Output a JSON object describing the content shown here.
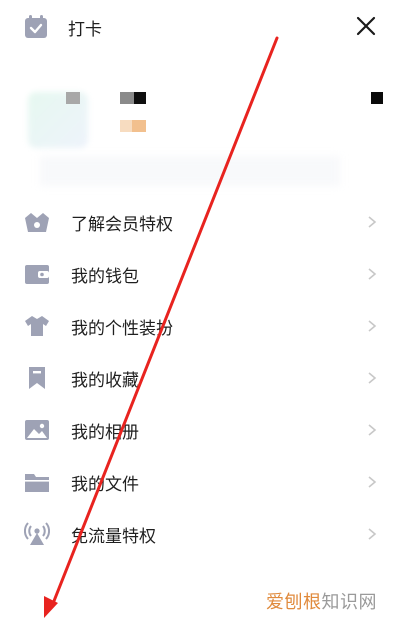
{
  "header": {
    "checkin_label": "打卡",
    "checkin_icon": "calendar-check-icon",
    "close_icon": "close-icon"
  },
  "menu": {
    "items": [
      {
        "label": "了解会员特权",
        "icon": "vip-crown-icon"
      },
      {
        "label": "我的钱包",
        "icon": "wallet-icon"
      },
      {
        "label": "我的个性装扮",
        "icon": "tshirt-icon"
      },
      {
        "label": "我的收藏",
        "icon": "bookmark-icon"
      },
      {
        "label": "我的相册",
        "icon": "photo-icon"
      },
      {
        "label": "我的文件",
        "icon": "folder-icon"
      },
      {
        "label": "免流量特权",
        "icon": "signal-tower-icon"
      }
    ]
  },
  "watermark": {
    "part1": "爱刨根",
    "part2": "知识网"
  },
  "colors": {
    "icon": "#9ea2b5",
    "text": "#1f1f1f",
    "chevron": "#c8c8c8",
    "annotation": "#e8231f"
  }
}
